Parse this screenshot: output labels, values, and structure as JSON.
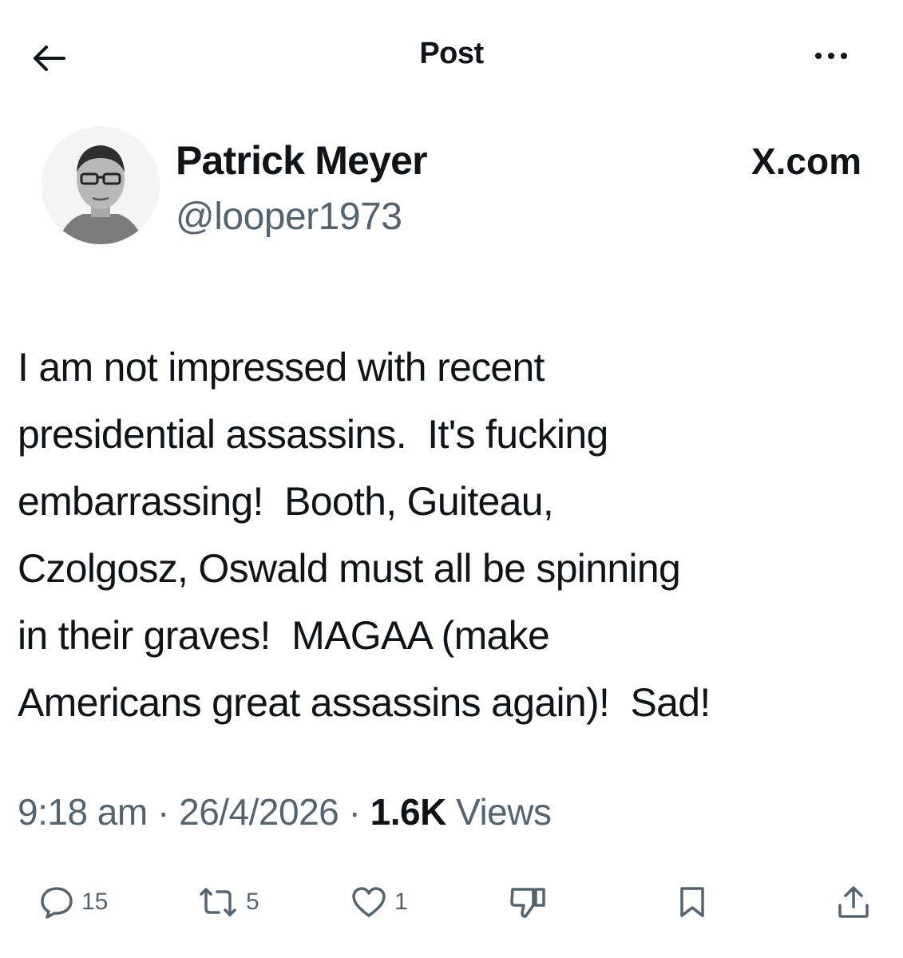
{
  "header": {
    "title": "Post",
    "back_icon": "arrow-left-icon",
    "more_icon": "ellipsis-icon"
  },
  "author": {
    "name": "Patrick Meyer",
    "handle": "@looper1973",
    "source": "X.com"
  },
  "post": {
    "text": "I am not impressed with recent\npresidential assassins.  It's fucking\nembarrassing!  Booth, Guiteau,\nCzolgosz, Oswald must all be spinning\nin their graves!  MAGAA (make\nAmericans great assassins again)!  Sad!",
    "time": "9:18 am",
    "separator": "·",
    "date": "26/4/2026",
    "views_count": "1.6K",
    "views_label": "Views"
  },
  "actions": {
    "replies": "15",
    "reposts": "5",
    "likes": "1"
  },
  "colors": {
    "text": "#0f1419",
    "secondary": "#536471",
    "background": "#ffffff"
  }
}
